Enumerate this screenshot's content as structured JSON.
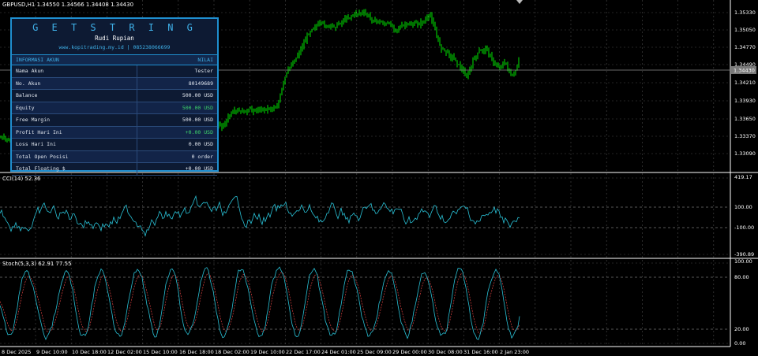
{
  "main": {
    "symbol_line": "GBPUSD,H1  1.34550 1.34566 1.34408 1.34430",
    "price_labels": [
      "1.35330",
      "1.35050",
      "1.34770",
      "1.34490",
      "1.34210",
      "1.33930",
      "1.33650",
      "1.33370",
      "1.33090"
    ],
    "current_price": "1.34430",
    "colors": {
      "up": "#00ff00",
      "down": "#00ff00",
      "grid": "#4a4a4a",
      "current": "#bfbfbf"
    }
  },
  "cci": {
    "label": "CCI(14) 52.36",
    "levels": [
      "419.17",
      "100.00",
      "-100.00",
      "-390.89"
    ],
    "color": "#29c1d6"
  },
  "stoch": {
    "label": "Stoch(5,3,3) 62.91 77.55",
    "levels": [
      "100.00",
      "80.00",
      "20.00",
      "0.00"
    ],
    "main_color": "#29c1d6",
    "signal_color": "#d94040"
  },
  "time_labels": [
    "8 Dec 2025",
    "9 Dec 10:00",
    "10 Dec 18:00",
    "12 Dec 02:00",
    "15 Dec 10:00",
    "16 Dec 18:00",
    "18 Dec 02:00",
    "19 Dec 10:00",
    "22 Dec 17:00",
    "24 Dec 01:00",
    "25 Dec 09:00",
    "29 Dec 00:00",
    "30 Dec 08:00",
    "31 Dec 16:00",
    "2 Jan 23:00"
  ],
  "panel": {
    "brand": "G E T S T R I N G",
    "owner": "Rudi Rupian",
    "contact": "www.kopitrading.my.id  |  085238066699",
    "header_left": "INFORMASI AKUN",
    "header_right": "NILAI",
    "rows": [
      {
        "label": "Nama Akun",
        "value": "Tester"
      },
      {
        "label": "No. Akun",
        "value": "80149689"
      },
      {
        "label": "Balance",
        "value": "500.00 USD"
      },
      {
        "label": "Equity",
        "value": "500.00 USD"
      },
      {
        "label": "Free Margin",
        "value": "500.00 USD"
      },
      {
        "label": "Profit Hari Ini",
        "value": "+0.00 USD"
      },
      {
        "label": "Loss Hari Ini",
        "value": "0.00 USD"
      },
      {
        "label": "Total Open Posisi",
        "value": "0 order"
      },
      {
        "label": "Total Floating $",
        "value": "+0.00 USD"
      }
    ]
  }
}
